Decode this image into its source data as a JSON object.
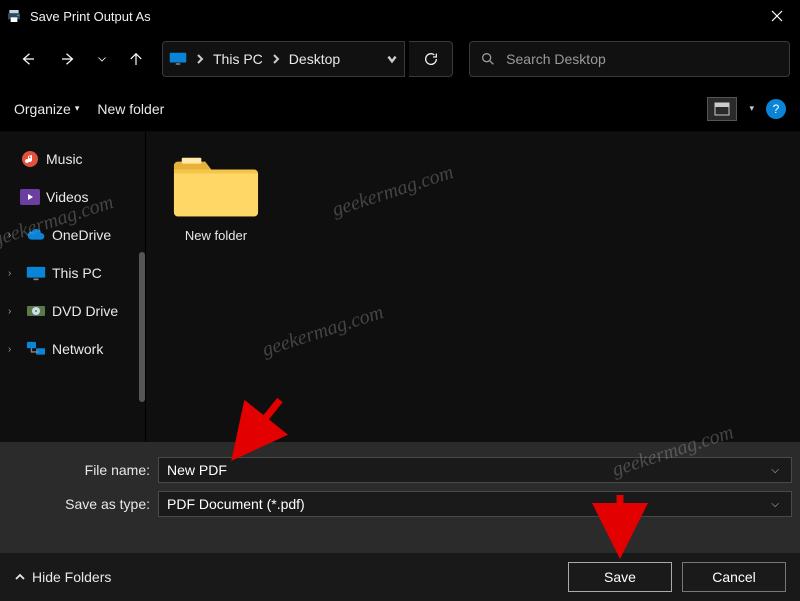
{
  "window": {
    "title": "Save Print Output As"
  },
  "nav": {
    "crumbs": [
      "This PC",
      "Desktop"
    ],
    "search_placeholder": "Search Desktop"
  },
  "toolbar": {
    "organize": "Organize",
    "newfolder": "New folder",
    "help_label": "?"
  },
  "sidebar": {
    "items": [
      {
        "label": "Music",
        "icon": "music"
      },
      {
        "label": "Videos",
        "icon": "video"
      },
      {
        "label": "OneDrive",
        "icon": "cloud"
      },
      {
        "label": "This PC",
        "icon": "pc"
      },
      {
        "label": "DVD Drive",
        "icon": "dvd"
      },
      {
        "label": "Network",
        "icon": "network"
      }
    ]
  },
  "content": {
    "folders": [
      {
        "label": "New folder"
      }
    ]
  },
  "form": {
    "filename_label": "File name:",
    "filename_value": "New PDF",
    "saveastype_label": "Save as type:",
    "saveastype_value": "PDF Document (*.pdf)"
  },
  "footer": {
    "hidefolders": "Hide Folders",
    "save": "Save",
    "cancel": "Cancel"
  },
  "watermark": "geekermag.com"
}
